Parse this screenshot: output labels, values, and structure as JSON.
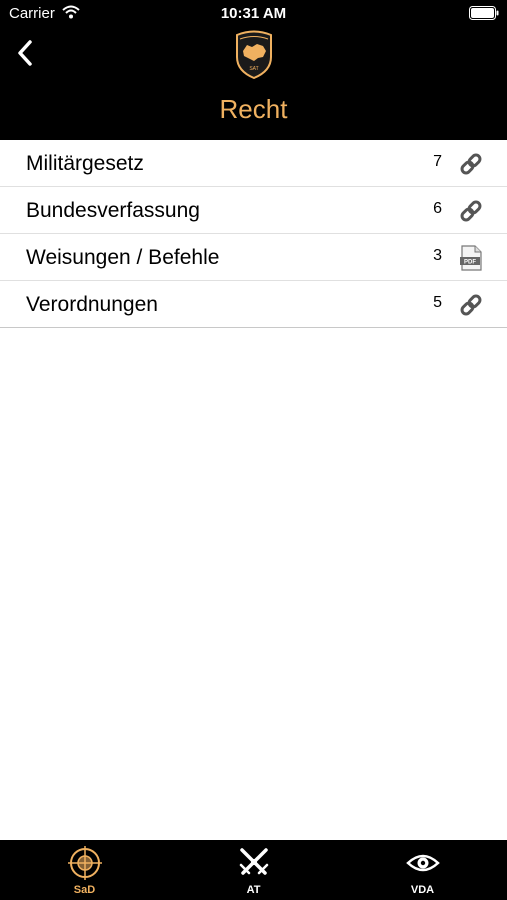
{
  "status_bar": {
    "carrier": "Carrier",
    "time": "10:31 AM"
  },
  "header": {
    "title": "Recht",
    "logo_text": "SAT"
  },
  "colors": {
    "accent": "#f0b160",
    "header_bg": "#000000",
    "background": "#ffffff"
  },
  "items": [
    {
      "label": "Militärgesetz",
      "count": "7",
      "icon": "link-icon"
    },
    {
      "label": "Bundesverfassung",
      "count": "6",
      "icon": "link-icon"
    },
    {
      "label": "Weisungen / Befehle",
      "count": "3",
      "icon": "pdf-icon"
    },
    {
      "label": "Verordnungen",
      "count": "5",
      "icon": "link-icon"
    }
  ],
  "tabs": [
    {
      "label": "SaD",
      "icon": "crosshair-icon",
      "active": true
    },
    {
      "label": "AT",
      "icon": "crossed-swords-icon",
      "active": false
    },
    {
      "label": "VDA",
      "icon": "eye-icon",
      "active": false
    }
  ]
}
